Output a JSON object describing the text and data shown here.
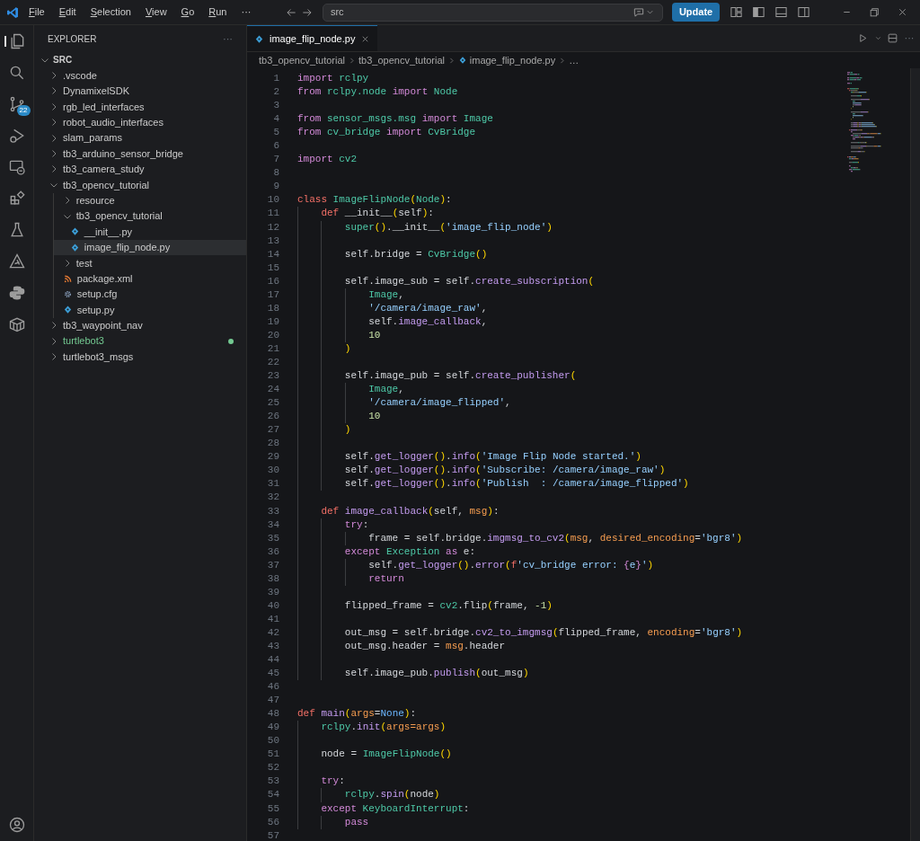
{
  "title_bar": {
    "menu": [
      "File",
      "Edit",
      "Selection",
      "View",
      "Go",
      "Run",
      "···"
    ],
    "command_center": "src",
    "update_button": "Update"
  },
  "activity_bar": [
    {
      "kind": "explorer",
      "selected": true
    },
    {
      "kind": "search",
      "selected": false
    },
    {
      "kind": "source-control",
      "selected": false,
      "badge": "22"
    },
    {
      "kind": "run-debug",
      "selected": false
    },
    {
      "kind": "remote",
      "selected": false
    },
    {
      "kind": "extensions",
      "selected": false
    },
    {
      "kind": "testing",
      "selected": false
    },
    {
      "kind": "ros",
      "selected": false
    },
    {
      "kind": "python",
      "selected": false
    },
    {
      "kind": "container",
      "selected": false
    },
    {
      "kind": "account",
      "selected": false
    }
  ],
  "sidebar": {
    "title": "EXPLORER",
    "more": "···",
    "section": {
      "label": "SRC",
      "expanded": true
    },
    "items": [
      {
        "label": ".vscode",
        "kind": "folder",
        "expanded": false,
        "selected": false,
        "modified": false
      },
      {
        "label": "DynamixelSDK",
        "kind": "folder",
        "expanded": false,
        "selected": false,
        "modified": false
      },
      {
        "label": "rgb_led_interfaces",
        "kind": "folder",
        "expanded": false,
        "selected": false,
        "modified": false
      },
      {
        "label": "robot_audio_interfaces",
        "kind": "folder",
        "expanded": false,
        "selected": false,
        "modified": false
      },
      {
        "label": "slam_params",
        "kind": "folder",
        "expanded": false,
        "selected": false,
        "modified": false
      },
      {
        "label": "tb3_arduino_sensor_bridge",
        "kind": "folder",
        "expanded": false,
        "selected": false,
        "modified": false
      },
      {
        "label": "tb3_camera_study",
        "kind": "folder",
        "expanded": false,
        "selected": false,
        "modified": false
      },
      {
        "label": "tb3_opencv_tutorial",
        "kind": "folder",
        "expanded": true,
        "selected": false,
        "modified": false,
        "children": [
          {
            "label": "resource",
            "kind": "folder",
            "expanded": false,
            "selected": false,
            "modified": false
          },
          {
            "label": "tb3_opencv_tutorial",
            "kind": "folder",
            "expanded": true,
            "selected": false,
            "modified": false,
            "children": [
              {
                "label": "__init__.py",
                "kind": "python",
                "selected": false,
                "modified": false
              },
              {
                "label": "image_flip_node.py",
                "kind": "python",
                "selected": true,
                "modified": false
              }
            ]
          },
          {
            "label": "test",
            "kind": "folder",
            "expanded": false,
            "selected": false,
            "modified": false
          },
          {
            "label": "package.xml",
            "kind": "xml",
            "selected": false,
            "modified": false
          },
          {
            "label": "setup.cfg",
            "kind": "config",
            "selected": false,
            "modified": false
          },
          {
            "label": "setup.py",
            "kind": "python",
            "selected": false,
            "modified": false
          }
        ]
      },
      {
        "label": "tb3_waypoint_nav",
        "kind": "folder",
        "expanded": false,
        "selected": false,
        "modified": false
      },
      {
        "label": "turtlebot3",
        "kind": "folder",
        "expanded": false,
        "selected": false,
        "modified": true
      },
      {
        "label": "turtlebot3_msgs",
        "kind": "folder",
        "expanded": false,
        "selected": false,
        "modified": false
      }
    ]
  },
  "editor": {
    "tabs": [
      {
        "label": "image_flip_node.py",
        "selected": true
      }
    ],
    "more": "···",
    "breadcrumbs": [
      {
        "label": "tb3_opencv_tutorial",
        "kind": "folder"
      },
      {
        "label": "tb3_opencv_tutorial",
        "kind": "folder"
      },
      {
        "label": "image_flip_node.py",
        "kind": "python"
      },
      {
        "label": "…",
        "kind": "more"
      }
    ],
    "lines": [
      {
        "number": "1",
        "tokens": [
          {
            "text": "import",
            "kind": "kw"
          },
          {
            "text": " rclpy",
            "kind": "type"
          }
        ]
      },
      {
        "number": "2",
        "tokens": [
          {
            "text": "from",
            "kind": "kw"
          },
          {
            "text": " rclpy.node ",
            "kind": "type"
          },
          {
            "text": "import",
            "kind": "kw"
          },
          {
            "text": " Node",
            "kind": "type"
          }
        ]
      },
      {
        "number": "3"
      },
      {
        "number": "4",
        "tokens": [
          {
            "text": "from",
            "kind": "kw"
          },
          {
            "text": " sensor_msgs.msg ",
            "kind": "type"
          },
          {
            "text": "import",
            "kind": "kw"
          },
          {
            "text": " Image",
            "kind": "type"
          }
        ]
      },
      {
        "number": "5",
        "tokens": [
          {
            "text": "from",
            "kind": "kw"
          },
          {
            "text": " cv_bridge ",
            "kind": "type"
          },
          {
            "text": "import",
            "kind": "kw"
          },
          {
            "text": " CvBridge",
            "kind": "type"
          }
        ]
      },
      {
        "number": "6"
      },
      {
        "number": "7",
        "tokens": [
          {
            "text": "import",
            "kind": "kw"
          },
          {
            "text": " cv2",
            "kind": "type"
          }
        ]
      },
      {
        "number": "8"
      },
      {
        "number": "9"
      },
      {
        "number": "10",
        "tokens": [
          {
            "text": "class",
            "kind": "def"
          },
          {
            "text": " ImageFlipNode",
            "kind": "type"
          },
          {
            "text": "(",
            "kind": "br"
          },
          {
            "text": "Node",
            "kind": "type"
          },
          {
            "text": ")",
            "kind": "br"
          },
          {
            "text": ":",
            "kind": "plain"
          }
        ]
      },
      {
        "number": "11",
        "tokens": [
          {
            "text": "    def",
            "kind": "def"
          },
          {
            "text": " __init__",
            "kind": "plain"
          },
          {
            "text": "(",
            "kind": "br"
          },
          {
            "text": "self",
            "kind": "plain"
          },
          {
            "text": ")",
            "kind": "br"
          },
          {
            "text": ":",
            "kind": "plain"
          }
        ]
      },
      {
        "number": "12",
        "tokens": [
          {
            "text": "        super",
            "kind": "type"
          },
          {
            "text": "()",
            "kind": "br"
          },
          {
            "text": ".__init__",
            "kind": "plain"
          },
          {
            "text": "(",
            "kind": "br"
          },
          {
            "text": "'image_flip_node'",
            "kind": "str"
          },
          {
            "text": ")",
            "kind": "br"
          }
        ]
      },
      {
        "number": "13"
      },
      {
        "number": "14",
        "tokens": [
          {
            "text": "        self.bridge = ",
            "kind": "plain"
          },
          {
            "text": "CvBridge",
            "kind": "type"
          },
          {
            "text": "()",
            "kind": "br"
          }
        ]
      },
      {
        "number": "15"
      },
      {
        "number": "16",
        "tokens": [
          {
            "text": "        self.image_sub = self.",
            "kind": "plain"
          },
          {
            "text": "create_subscription",
            "kind": "fn"
          },
          {
            "text": "(",
            "kind": "br"
          }
        ]
      },
      {
        "number": "17",
        "tokens": [
          {
            "text": "            Image",
            "kind": "type"
          },
          {
            "text": ",",
            "kind": "plain"
          }
        ]
      },
      {
        "number": "18",
        "tokens": [
          {
            "text": "            '/camera/image_raw'",
            "kind": "str"
          },
          {
            "text": ",",
            "kind": "plain"
          }
        ]
      },
      {
        "number": "19",
        "tokens": [
          {
            "text": "            self.",
            "kind": "plain"
          },
          {
            "text": "image_callback",
            "kind": "fn"
          },
          {
            "text": ",",
            "kind": "plain"
          }
        ]
      },
      {
        "number": "20",
        "tokens": [
          {
            "text": "            10",
            "kind": "num"
          }
        ]
      },
      {
        "number": "21",
        "tokens": [
          {
            "text": "        )",
            "kind": "br"
          }
        ]
      },
      {
        "number": "22"
      },
      {
        "number": "23",
        "tokens": [
          {
            "text": "        self.image_pub = self.",
            "kind": "plain"
          },
          {
            "text": "create_publisher",
            "kind": "fn"
          },
          {
            "text": "(",
            "kind": "br"
          }
        ]
      },
      {
        "number": "24",
        "tokens": [
          {
            "text": "            Image",
            "kind": "type"
          },
          {
            "text": ",",
            "kind": "plain"
          }
        ]
      },
      {
        "number": "25",
        "tokens": [
          {
            "text": "            '/camera/image_flipped'",
            "kind": "str"
          },
          {
            "text": ",",
            "kind": "plain"
          }
        ]
      },
      {
        "number": "26",
        "tokens": [
          {
            "text": "            10",
            "kind": "num"
          }
        ]
      },
      {
        "number": "27",
        "tokens": [
          {
            "text": "        )",
            "kind": "br"
          }
        ]
      },
      {
        "number": "28"
      },
      {
        "number": "29",
        "tokens": [
          {
            "text": "        self.",
            "kind": "plain"
          },
          {
            "text": "get_logger",
            "kind": "fn"
          },
          {
            "text": "()",
            "kind": "br"
          },
          {
            "text": ".",
            "kind": "plain"
          },
          {
            "text": "info",
            "kind": "fn"
          },
          {
            "text": "(",
            "kind": "br"
          },
          {
            "text": "'Image Flip Node started.'",
            "kind": "str"
          },
          {
            "text": ")",
            "kind": "br"
          }
        ]
      },
      {
        "number": "30",
        "tokens": [
          {
            "text": "        self.",
            "kind": "plain"
          },
          {
            "text": "get_logger",
            "kind": "fn"
          },
          {
            "text": "()",
            "kind": "br"
          },
          {
            "text": ".",
            "kind": "plain"
          },
          {
            "text": "info",
            "kind": "fn"
          },
          {
            "text": "(",
            "kind": "br"
          },
          {
            "text": "'Subscribe: /camera/image_raw'",
            "kind": "str"
          },
          {
            "text": ")",
            "kind": "br"
          }
        ]
      },
      {
        "number": "31",
        "tokens": [
          {
            "text": "        self.",
            "kind": "plain"
          },
          {
            "text": "get_logger",
            "kind": "fn"
          },
          {
            "text": "()",
            "kind": "br"
          },
          {
            "text": ".",
            "kind": "plain"
          },
          {
            "text": "info",
            "kind": "fn"
          },
          {
            "text": "(",
            "kind": "br"
          },
          {
            "text": "'Publish  : /camera/image_flipped'",
            "kind": "str"
          },
          {
            "text": ")",
            "kind": "br"
          }
        ]
      },
      {
        "number": "32"
      },
      {
        "number": "33",
        "tokens": [
          {
            "text": "    def",
            "kind": "def"
          },
          {
            "text": " image_callback",
            "kind": "fn"
          },
          {
            "text": "(",
            "kind": "br"
          },
          {
            "text": "self, ",
            "kind": "plain"
          },
          {
            "text": "msg",
            "kind": "param"
          },
          {
            "text": ")",
            "kind": "br"
          },
          {
            "text": ":",
            "kind": "plain"
          }
        ]
      },
      {
        "number": "34",
        "tokens": [
          {
            "text": "        try",
            "kind": "kw"
          },
          {
            "text": ":",
            "kind": "plain"
          }
        ]
      },
      {
        "number": "35",
        "tokens": [
          {
            "text": "            frame = self.bridge.",
            "kind": "plain"
          },
          {
            "text": "imgmsg_to_cv2",
            "kind": "fn"
          },
          {
            "text": "(",
            "kind": "br"
          },
          {
            "text": "msg",
            "kind": "param"
          },
          {
            "text": ", ",
            "kind": "plain"
          },
          {
            "text": "desired_encoding",
            "kind": "param"
          },
          {
            "text": "=",
            "kind": "plain"
          },
          {
            "text": "'bgr8'",
            "kind": "str"
          },
          {
            "text": ")",
            "kind": "br"
          }
        ]
      },
      {
        "number": "36",
        "tokens": [
          {
            "text": "        except",
            "kind": "kw"
          },
          {
            "text": " Exception",
            "kind": "type"
          },
          {
            "text": " as",
            "kind": "kw"
          },
          {
            "text": " e:",
            "kind": "plain"
          }
        ]
      },
      {
        "number": "37",
        "tokens": [
          {
            "text": "            self.",
            "kind": "plain"
          },
          {
            "text": "get_logger",
            "kind": "fn"
          },
          {
            "text": "()",
            "kind": "br"
          },
          {
            "text": ".",
            "kind": "plain"
          },
          {
            "text": "error",
            "kind": "fn"
          },
          {
            "text": "(",
            "kind": "br"
          },
          {
            "text": "f",
            "kind": "def"
          },
          {
            "text": "'cv_bridge error: ",
            "kind": "str"
          },
          {
            "text": "{",
            "kind": "kw"
          },
          {
            "text": "e",
            "kind": "str"
          },
          {
            "text": "}",
            "kind": "kw"
          },
          {
            "text": "'",
            "kind": "str"
          },
          {
            "text": ")",
            "kind": "br"
          }
        ]
      },
      {
        "number": "38",
        "tokens": [
          {
            "text": "            return",
            "kind": "kw"
          }
        ]
      },
      {
        "number": "39"
      },
      {
        "number": "40",
        "tokens": [
          {
            "text": "        flipped_frame = ",
            "kind": "plain"
          },
          {
            "text": "cv2",
            "kind": "type"
          },
          {
            "text": ".flip",
            "kind": "plain"
          },
          {
            "text": "(",
            "kind": "br"
          },
          {
            "text": "frame, ",
            "kind": "plain"
          },
          {
            "text": "-1",
            "kind": "num"
          },
          {
            "text": ")",
            "kind": "br"
          }
        ]
      },
      {
        "number": "41"
      },
      {
        "number": "42",
        "tokens": [
          {
            "text": "        out_msg = self.bridge.",
            "kind": "plain"
          },
          {
            "text": "cv2_to_imgmsg",
            "kind": "fn"
          },
          {
            "text": "(",
            "kind": "br"
          },
          {
            "text": "flipped_frame, ",
            "kind": "plain"
          },
          {
            "text": "encoding",
            "kind": "param"
          },
          {
            "text": "=",
            "kind": "plain"
          },
          {
            "text": "'bgr8'",
            "kind": "str"
          },
          {
            "text": ")",
            "kind": "br"
          }
        ]
      },
      {
        "number": "43",
        "tokens": [
          {
            "text": "        out_msg.header = ",
            "kind": "plain"
          },
          {
            "text": "msg",
            "kind": "param"
          },
          {
            "text": ".header",
            "kind": "plain"
          }
        ]
      },
      {
        "number": "44"
      },
      {
        "number": "45",
        "tokens": [
          {
            "text": "        self.image_pub.",
            "kind": "plain"
          },
          {
            "text": "publish",
            "kind": "fn"
          },
          {
            "text": "(",
            "kind": "br"
          },
          {
            "text": "out_msg",
            "kind": "plain"
          },
          {
            "text": ")",
            "kind": "br"
          }
        ]
      },
      {
        "number": "46"
      },
      {
        "number": "47"
      },
      {
        "number": "48",
        "tokens": [
          {
            "text": "def",
            "kind": "def"
          },
          {
            "text": " main",
            "kind": "fn"
          },
          {
            "text": "(",
            "kind": "br"
          },
          {
            "text": "args",
            "kind": "param"
          },
          {
            "text": "=",
            "kind": "plain"
          },
          {
            "text": "None",
            "kind": "const"
          },
          {
            "text": ")",
            "kind": "br"
          },
          {
            "text": ":",
            "kind": "plain"
          }
        ]
      },
      {
        "number": "49",
        "tokens": [
          {
            "text": "    rclpy",
            "kind": "type"
          },
          {
            "text": ".",
            "kind": "plain"
          },
          {
            "text": "init",
            "kind": "fn"
          },
          {
            "text": "(",
            "kind": "br"
          },
          {
            "text": "args=args",
            "kind": "param"
          },
          {
            "text": ")",
            "kind": "br"
          }
        ]
      },
      {
        "number": "50"
      },
      {
        "number": "51",
        "tokens": [
          {
            "text": "    node = ",
            "kind": "plain"
          },
          {
            "text": "ImageFlipNode",
            "kind": "type"
          },
          {
            "text": "()",
            "kind": "br"
          }
        ]
      },
      {
        "number": "52"
      },
      {
        "number": "53",
        "tokens": [
          {
            "text": "    try",
            "kind": "kw"
          },
          {
            "text": ":",
            "kind": "plain"
          }
        ]
      },
      {
        "number": "54",
        "tokens": [
          {
            "text": "        rclpy",
            "kind": "type"
          },
          {
            "text": ".",
            "kind": "plain"
          },
          {
            "text": "spin",
            "kind": "fn"
          },
          {
            "text": "(",
            "kind": "br"
          },
          {
            "text": "node",
            "kind": "plain"
          },
          {
            "text": ")",
            "kind": "br"
          }
        ]
      },
      {
        "number": "55",
        "tokens": [
          {
            "text": "    except",
            "kind": "kw"
          },
          {
            "text": " KeyboardInterrupt",
            "kind": "type"
          },
          {
            "text": ":",
            "kind": "plain"
          }
        ]
      },
      {
        "number": "56",
        "tokens": [
          {
            "text": "        pass",
            "kind": "kw"
          }
        ]
      },
      {
        "number": "57"
      }
    ]
  }
}
